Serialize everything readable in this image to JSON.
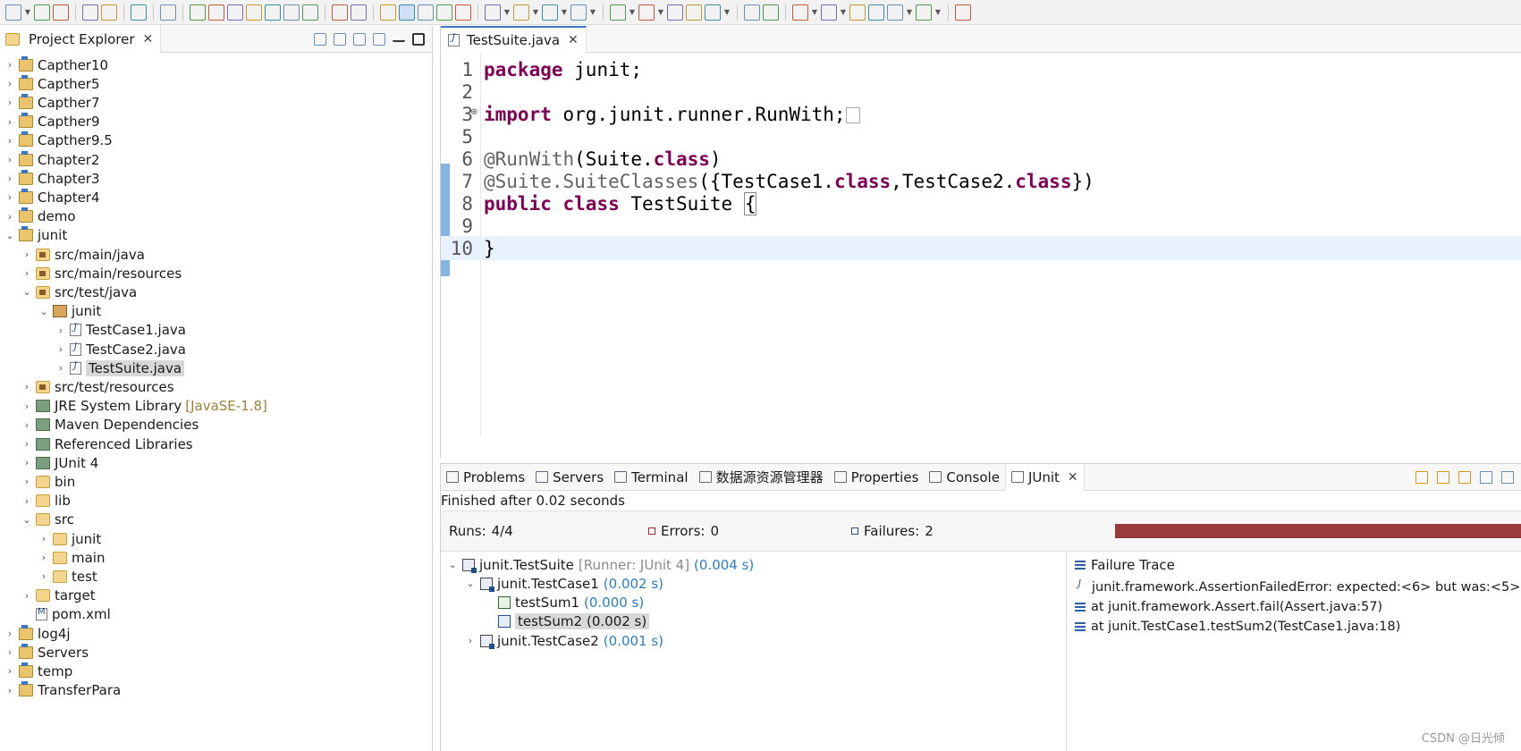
{
  "project_explorer": {
    "title": "Project Explorer",
    "items": [
      {
        "label": "Capther10",
        "indent": 0,
        "expanded": false,
        "icon": "project-icon"
      },
      {
        "label": "Capther5",
        "indent": 0,
        "expanded": false,
        "icon": "project-icon"
      },
      {
        "label": "Capther7",
        "indent": 0,
        "expanded": false,
        "icon": "project-icon"
      },
      {
        "label": "Capther9",
        "indent": 0,
        "expanded": false,
        "icon": "project-icon"
      },
      {
        "label": "Capther9.5",
        "indent": 0,
        "expanded": false,
        "icon": "project-icon"
      },
      {
        "label": "Chapter2",
        "indent": 0,
        "expanded": false,
        "icon": "project-icon"
      },
      {
        "label": "Chapter3",
        "indent": 0,
        "expanded": false,
        "icon": "project-icon"
      },
      {
        "label": "Chapter4",
        "indent": 0,
        "expanded": false,
        "icon": "project-icon"
      },
      {
        "label": "demo",
        "indent": 0,
        "expanded": false,
        "icon": "project-icon"
      },
      {
        "label": "junit",
        "indent": 0,
        "expanded": true,
        "icon": "project-icon"
      },
      {
        "label": "src/main/java",
        "indent": 1,
        "expanded": false,
        "icon": "source-folder-icon"
      },
      {
        "label": "src/main/resources",
        "indent": 1,
        "expanded": false,
        "icon": "source-folder-icon"
      },
      {
        "label": "src/test/java",
        "indent": 1,
        "expanded": true,
        "icon": "source-folder-icon"
      },
      {
        "label": "junit",
        "indent": 2,
        "expanded": true,
        "icon": "package-icon"
      },
      {
        "label": "TestCase1.java",
        "indent": 3,
        "expanded": false,
        "icon": "java-file-icon"
      },
      {
        "label": "TestCase2.java",
        "indent": 3,
        "expanded": false,
        "icon": "java-file-icon"
      },
      {
        "label": "TestSuite.java",
        "indent": 3,
        "expanded": false,
        "icon": "java-file-icon",
        "selected": true
      },
      {
        "label": "src/test/resources",
        "indent": 1,
        "expanded": false,
        "icon": "source-folder-icon"
      },
      {
        "label": "JRE System Library",
        "suffix": "[JavaSE-1.8]",
        "indent": 1,
        "expanded": false,
        "icon": "library-icon"
      },
      {
        "label": "Maven Dependencies",
        "indent": 1,
        "expanded": false,
        "icon": "library-icon"
      },
      {
        "label": "Referenced Libraries",
        "indent": 1,
        "expanded": false,
        "icon": "library-icon"
      },
      {
        "label": "JUnit 4",
        "indent": 1,
        "expanded": false,
        "icon": "library-icon"
      },
      {
        "label": "bin",
        "indent": 1,
        "expanded": false,
        "icon": "folder-icon"
      },
      {
        "label": "lib",
        "indent": 1,
        "expanded": false,
        "icon": "folder-icon"
      },
      {
        "label": "src",
        "indent": 1,
        "expanded": true,
        "icon": "folder-icon"
      },
      {
        "label": "junit",
        "indent": 2,
        "expanded": false,
        "icon": "folder-icon"
      },
      {
        "label": "main",
        "indent": 2,
        "expanded": false,
        "icon": "folder-icon"
      },
      {
        "label": "test",
        "indent": 2,
        "expanded": false,
        "icon": "folder-icon"
      },
      {
        "label": "target",
        "indent": 1,
        "expanded": false,
        "icon": "folder-icon"
      },
      {
        "label": "pom.xml",
        "indent": 1,
        "expanded": null,
        "icon": "xml-file-icon"
      },
      {
        "label": "log4j",
        "indent": 0,
        "expanded": false,
        "icon": "project-icon"
      },
      {
        "label": "Servers",
        "indent": 0,
        "expanded": false,
        "icon": "project-icon"
      },
      {
        "label": "temp",
        "indent": 0,
        "expanded": false,
        "icon": "project-icon"
      },
      {
        "label": "TransferPara",
        "indent": 0,
        "expanded": false,
        "icon": "project-icon"
      }
    ]
  },
  "editor": {
    "tab_label": "TestSuite.java",
    "lines": [
      {
        "num": "1",
        "html": "<span class='kw'>package</span> junit;"
      },
      {
        "num": "2",
        "html": ""
      },
      {
        "num": "3",
        "html": "<span class='kw'>import</span> org.junit.runner.RunWith;<span style='border:1px solid #aaa;font-size:14px;padding:0 3px;vertical-align:middle;'>&nbsp;</span>"
      },
      {
        "num": "5",
        "html": ""
      },
      {
        "num": "6",
        "html": "<span class='anno'>@RunWith</span>(Suite.<span class='kw'>class</span>)"
      },
      {
        "num": "7",
        "html": "<span class='anno'>@Suite.</span><span class='anno'>SuiteClasses</span>({TestCase1.<span class='kw'>class</span>,TestCase2.<span class='kw'>class</span>})"
      },
      {
        "num": "8",
        "html": "<span class='kw'>public</span> <span class='kw'>class</span> TestSuite <span style='border:1px solid #888;'>{</span>"
      },
      {
        "num": "9",
        "html": ""
      },
      {
        "num": "10",
        "html": "}",
        "current": true
      }
    ]
  },
  "bottom_panel": {
    "tabs": [
      {
        "label": "Problems",
        "icon": "problems-icon",
        "active": false
      },
      {
        "label": "Servers",
        "icon": "servers-icon",
        "active": false
      },
      {
        "label": "Terminal",
        "icon": "terminal-icon",
        "active": false
      },
      {
        "label": "数据源资源管理器",
        "icon": "datasource-icon",
        "active": false
      },
      {
        "label": "Properties",
        "icon": "properties-icon",
        "active": false
      },
      {
        "label": "Console",
        "icon": "console-icon",
        "active": false
      },
      {
        "label": "JUnit",
        "icon": "junit-icon",
        "active": true
      }
    ],
    "finished_text": "Finished after 0.02 seconds",
    "runs_label": "Runs:",
    "runs_value": "4/4",
    "errors_label": "Errors:",
    "errors_value": "0",
    "failures_label": "Failures:",
    "failures_value": "2",
    "progress_color": "#9b3a3a",
    "test_tree": [
      {
        "label": "junit.TestSuite",
        "runner": "[Runner: JUnit 4]",
        "time": "(0.004 s)",
        "indent": 0,
        "expanded": true,
        "type": "suite"
      },
      {
        "label": "junit.TestCase1",
        "time": "(0.002 s)",
        "indent": 1,
        "expanded": true,
        "type": "suite"
      },
      {
        "label": "testSum1",
        "time": "(0.000 s)",
        "indent": 2,
        "expanded": null,
        "type": "test"
      },
      {
        "label": "testSum2",
        "time": "(0.002 s)",
        "indent": 2,
        "expanded": null,
        "type": "test",
        "selected": true
      },
      {
        "label": "junit.TestCase2",
        "time": "(0.001 s)",
        "indent": 1,
        "expanded": false,
        "type": "suite"
      }
    ],
    "failure_trace": {
      "title": "Failure Trace",
      "lines": [
        "junit.framework.AssertionFailedError: expected:<6> but was:<5>",
        "at junit.framework.Assert.fail(Assert.java:57)",
        "at junit.TestCase1.testSum2(TestCase1.java:18)"
      ]
    }
  },
  "watermark": "CSDN @日光倾"
}
